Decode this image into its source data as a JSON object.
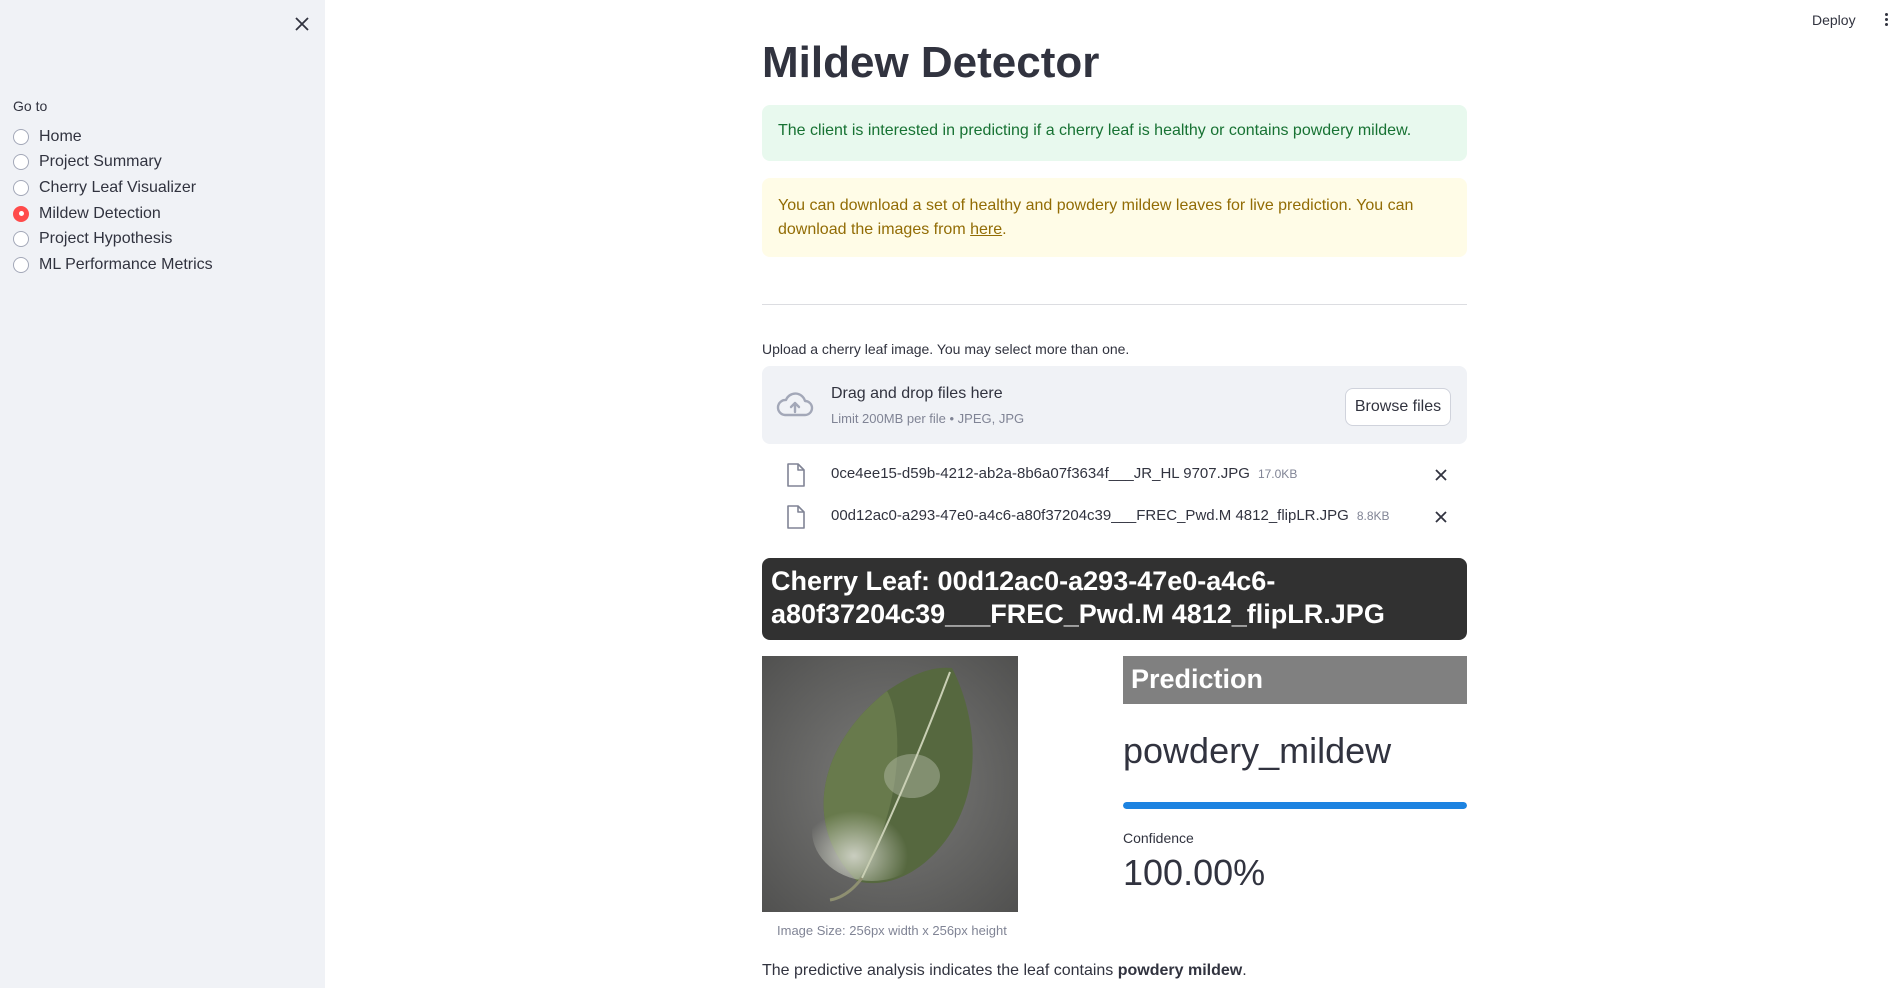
{
  "sidebar": {
    "nav_title": "Go to",
    "items": [
      {
        "label": "Home",
        "selected": false
      },
      {
        "label": "Project Summary",
        "selected": false
      },
      {
        "label": "Cherry Leaf Visualizer",
        "selected": false
      },
      {
        "label": "Mildew Detection",
        "selected": true
      },
      {
        "label": "Project Hypothesis",
        "selected": false
      },
      {
        "label": "ML Performance Metrics",
        "selected": false
      }
    ]
  },
  "header": {
    "deploy_label": "Deploy"
  },
  "main": {
    "title": "Mildew Detector",
    "info_success": "The client is interested in predicting if a cherry leaf is healthy or contains powdery mildew.",
    "info_warning_text": "You can download a set of healthy and powdery mildew leaves for live prediction. You can download the images from ",
    "info_warning_link": "here",
    "info_warning_end": ".",
    "uploader": {
      "label": "Upload a cherry leaf image. You may select more than one.",
      "drop_title": "Drag and drop files here",
      "drop_limit": "Limit 200MB per file • JPEG, JPG",
      "browse_label": "Browse files",
      "files": [
        {
          "name": "0ce4ee15-d59b-4212-ab2a-8b6a07f3634f___JR_HL 9707.JPG",
          "size": "17.0KB"
        },
        {
          "name": "00d12ac0-a293-47e0-a4c6-a80f37204c39___FREC_Pwd.M 4812_flipLR.JPG",
          "size": "8.8KB"
        }
      ]
    },
    "leaf_header_line1": "Cherry Leaf: 00d12ac0-a293-47e0-a4c6-",
    "leaf_header_line2": "a80f37204c39___FREC_Pwd.M 4812_flipLR.JPG",
    "image_caption": "Image Size: 256px width x 256px height",
    "prediction": {
      "header": "Prediction",
      "value": "powdery_mildew",
      "progress_fraction": 1.0,
      "confidence_label": "Confidence",
      "confidence_value": "100.00%"
    },
    "summary_prefix": "The predictive analysis indicates the leaf contains ",
    "summary_bold": "powdery mildew",
    "summary_suffix": "."
  },
  "colors": {
    "accent": "#ff4b4b",
    "progress": "#1c83e1",
    "sidebar_bg": "#f0f2f6"
  }
}
